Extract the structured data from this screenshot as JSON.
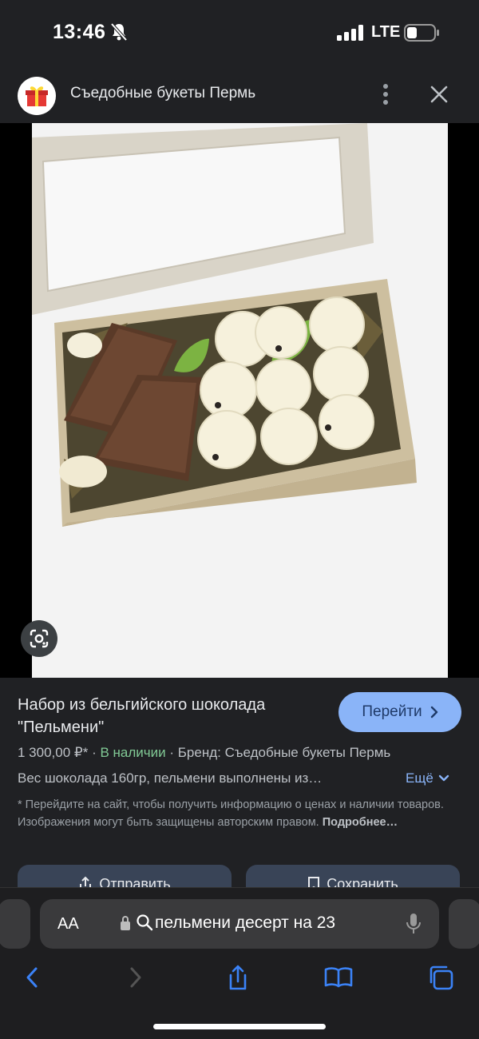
{
  "status_bar": {
    "time": "13:46",
    "network": "LTE"
  },
  "header": {
    "site_title": "Съедобные букеты Пермь"
  },
  "product": {
    "title": "Набор из бельгийского шоколада \"Пельмени\"",
    "goto_label": "Перейти",
    "price": "1 300,00 ₽*",
    "availability": "В наличии",
    "brand": "Бренд: Съедобные букеты Пермь",
    "description": "Вес шоколада 160гр, пельмени выполнены из…",
    "more_label": "Ещё",
    "disclaimer": "* Перейдите на сайт, чтобы получить информацию о ценах и наличии товаров. Изображения могут быть защищены авторским правом.",
    "disclaimer_link": "Подробнее…",
    "share_label": "Отправить",
    "save_label": "Сохранить"
  },
  "browser": {
    "text_size_label": "AA",
    "url_text": "пельмени десерт на 23"
  },
  "colors": {
    "background": "#202124",
    "accent": "#8ab4f8",
    "in_stock": "#81c995",
    "button": "#394457"
  },
  "icons": [
    "bell-slash-icon",
    "signal-icon",
    "battery-icon",
    "gift-icon",
    "more-vert-icon",
    "close-icon",
    "google-lens-icon",
    "chevron-right-icon",
    "chevron-down-icon",
    "share-icon",
    "bookmark-icon",
    "lock-icon",
    "search-icon",
    "mic-icon",
    "back-icon",
    "forward-icon",
    "share-icon",
    "bookmarks-icon",
    "tabs-icon"
  ]
}
